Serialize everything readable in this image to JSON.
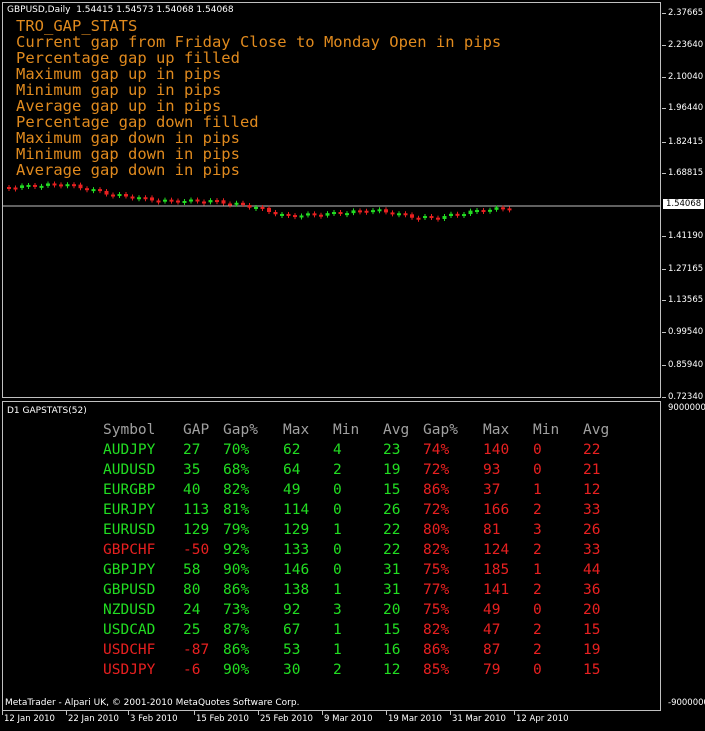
{
  "chart": {
    "title": "GBPUSD,Daily",
    "ohlc": "1.54415 1.54573 1.54068 1.54068",
    "overlay_lines": [
      "TRO_GAP_STATS",
      "Current gap from Friday Close to Monday Open in pips",
      "Percentage gap up filled",
      "Maximum gap up in pips",
      "Minimum gap up in pips",
      "Average gap up in pips",
      "Percentage gap down filled",
      "Maximum gap down in pips",
      "Minimum gap down in pips",
      "Average gap down in pips"
    ],
    "price_labels": [
      "2.37665",
      "2.23640",
      "2.10040",
      "1.96440",
      "1.82415",
      "1.68815",
      "1.54068",
      "1.41190",
      "1.27165",
      "1.13565",
      "0.99540",
      "0.85940",
      "0.72340"
    ],
    "current_price": "1.54068",
    "colors": {
      "bull": "#22dd22",
      "bear": "#e82020",
      "overlay_text": "#e08a1e"
    }
  },
  "indicator": {
    "title": "D1 GAPSTATS(52)",
    "scale_top": "9000000",
    "scale_bottom": "-9000000",
    "headers": [
      "Symbol",
      "GAP",
      "Gap%",
      "Max",
      "Min",
      "Avg",
      "Gap%",
      "Max",
      "Min",
      "Avg"
    ],
    "rows": [
      {
        "symbol": "AUDJPY",
        "gap": "27",
        "up_pct": "70%",
        "up_max": "62",
        "up_min": "4",
        "up_avg": "23",
        "dn_pct": "74%",
        "dn_max": "140",
        "dn_min": "0",
        "dn_avg": "22",
        "color": "green"
      },
      {
        "symbol": "AUDUSD",
        "gap": "35",
        "up_pct": "68%",
        "up_max": "64",
        "up_min": "2",
        "up_avg": "19",
        "dn_pct": "72%",
        "dn_max": "93",
        "dn_min": "0",
        "dn_avg": "21",
        "color": "green"
      },
      {
        "symbol": "EURGBP",
        "gap": "40",
        "up_pct": "82%",
        "up_max": "49",
        "up_min": "0",
        "up_avg": "15",
        "dn_pct": "86%",
        "dn_max": "37",
        "dn_min": "1",
        "dn_avg": "12",
        "color": "green"
      },
      {
        "symbol": "EURJPY",
        "gap": "113",
        "up_pct": "81%",
        "up_max": "114",
        "up_min": "0",
        "up_avg": "26",
        "dn_pct": "72%",
        "dn_max": "166",
        "dn_min": "2",
        "dn_avg": "33",
        "color": "green"
      },
      {
        "symbol": "EURUSD",
        "gap": "129",
        "up_pct": "79%",
        "up_max": "129",
        "up_min": "1",
        "up_avg": "22",
        "dn_pct": "80%",
        "dn_max": "81",
        "dn_min": "3",
        "dn_avg": "26",
        "color": "green"
      },
      {
        "symbol": "GBPCHF",
        "gap": "-50",
        "up_pct": "92%",
        "up_max": "133",
        "up_min": "0",
        "up_avg": "22",
        "dn_pct": "82%",
        "dn_max": "124",
        "dn_min": "2",
        "dn_avg": "33",
        "color": "red"
      },
      {
        "symbol": "GBPJPY",
        "gap": "58",
        "up_pct": "90%",
        "up_max": "146",
        "up_min": "0",
        "up_avg": "31",
        "dn_pct": "75%",
        "dn_max": "185",
        "dn_min": "1",
        "dn_avg": "44",
        "color": "green"
      },
      {
        "symbol": "GBPUSD",
        "gap": "80",
        "up_pct": "86%",
        "up_max": "138",
        "up_min": "1",
        "up_avg": "31",
        "dn_pct": "77%",
        "dn_max": "141",
        "dn_min": "2",
        "dn_avg": "36",
        "color": "green"
      },
      {
        "symbol": "NZDUSD",
        "gap": "24",
        "up_pct": "73%",
        "up_max": "92",
        "up_min": "3",
        "up_avg": "20",
        "dn_pct": "75%",
        "dn_max": "49",
        "dn_min": "0",
        "dn_avg": "20",
        "color": "green"
      },
      {
        "symbol": "USDCAD",
        "gap": "25",
        "up_pct": "87%",
        "up_max": "67",
        "up_min": "1",
        "up_avg": "15",
        "dn_pct": "82%",
        "dn_max": "47",
        "dn_min": "2",
        "dn_avg": "15",
        "color": "green"
      },
      {
        "symbol": "USDCHF",
        "gap": "-87",
        "up_pct": "86%",
        "up_max": "53",
        "up_min": "1",
        "up_avg": "16",
        "dn_pct": "86%",
        "dn_max": "87",
        "dn_min": "2",
        "dn_avg": "19",
        "color": "red"
      },
      {
        "symbol": "USDJPY",
        "gap": "-6",
        "up_pct": "90%",
        "up_max": "30",
        "up_min": "2",
        "up_avg": "12",
        "dn_pct": "85%",
        "dn_max": "79",
        "dn_min": "0",
        "dn_avg": "15",
        "color": "red"
      }
    ],
    "copyright": "MetaTrader - Alpari UK, © 2001-2010 MetaQuotes Software Corp."
  },
  "date_labels": [
    "12 Jan 2010",
    "22 Jan 2010",
    "3 Feb 2010",
    "15 Feb 2010",
    "25 Feb 2010",
    "9 Mar 2010",
    "19 Mar 2010",
    "31 Mar 2010",
    "12 Apr 2010"
  ]
}
